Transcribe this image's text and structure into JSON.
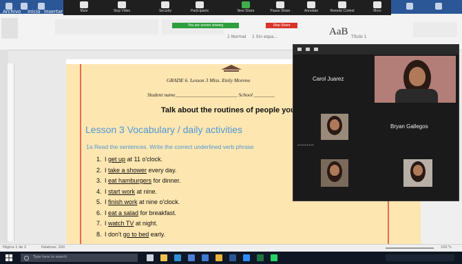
{
  "word": {
    "title_tabs": [
      "Archivo",
      "Inicio",
      "Insertar"
    ],
    "styles_sample": "AaB",
    "style_labels": [
      "1 Normal",
      "1 Sin espa...",
      "Título 1"
    ],
    "status_left": "Página 1 de 2",
    "status_words": "Palabras: 200",
    "zoom_level": "100 %"
  },
  "zoom_toolbar": {
    "items": [
      {
        "label": "Mute",
        "icon": "microphone-icon"
      },
      {
        "label": "Stop Video",
        "icon": "video-camera-icon"
      },
      {
        "label": "Security",
        "icon": "shield-icon"
      },
      {
        "label": "Participants",
        "icon": "participants-icon"
      },
      {
        "label": "New Share",
        "icon": "share-screen-icon"
      },
      {
        "label": "Pause Share",
        "icon": "pause-icon"
      },
      {
        "label": "Annotate",
        "icon": "pencil-icon"
      },
      {
        "label": "Remote Control",
        "icon": "remote-control-icon"
      },
      {
        "label": "More",
        "icon": "more-icon"
      }
    ],
    "sharing_text": "You are screen sharing",
    "stop_share_label": "Stop Share"
  },
  "document": {
    "header_line": "GRADE 6. Lesson 3 Miss. Enily Moreno",
    "student_line": "Student name________________________ School ________",
    "title": "Talk about the routines of people you",
    "lesson_heading": "Lesson 3 Vocabulary / daily activities",
    "instruction": "1a Read the sentences. Write the correct underlined verb phrase",
    "sentences": [
      {
        "num": "1.",
        "pre": "I ",
        "phrase": "get up",
        "post": " at 11 o'clock."
      },
      {
        "num": "2.",
        "pre": "I ",
        "phrase": "take a shower",
        "post": " every day."
      },
      {
        "num": "3.",
        "pre": "I ",
        "phrase": "eat hamburgers",
        "post": " for dinner."
      },
      {
        "num": "4.",
        "pre": "I ",
        "phrase": "start work",
        "post": " at nine."
      },
      {
        "num": "5.",
        "pre": "I ",
        "phrase": "finish work",
        "post": " at nine o'clock."
      },
      {
        "num": "6.",
        "pre": "I ",
        "phrase": "eat a salad",
        "post": " for breakfast."
      },
      {
        "num": "7.",
        "pre": "I ",
        "phrase": "watch TV",
        "post": " at night."
      },
      {
        "num": "8.",
        "pre": "I don't ",
        "phrase": "go to bed",
        "post": " early."
      }
    ]
  },
  "participants": {
    "carol": "Carol Juarez",
    "bryan": "Bryan Gallegos"
  },
  "taskbar": {
    "search_placeholder": "Type here to search"
  },
  "colors": {
    "page_bg": "#fde6b0",
    "lesson_blue": "#4f97d6",
    "zoom_dark": "#1a1a1a",
    "share_green": "#2e9f3e",
    "stop_red": "#d9342b"
  }
}
